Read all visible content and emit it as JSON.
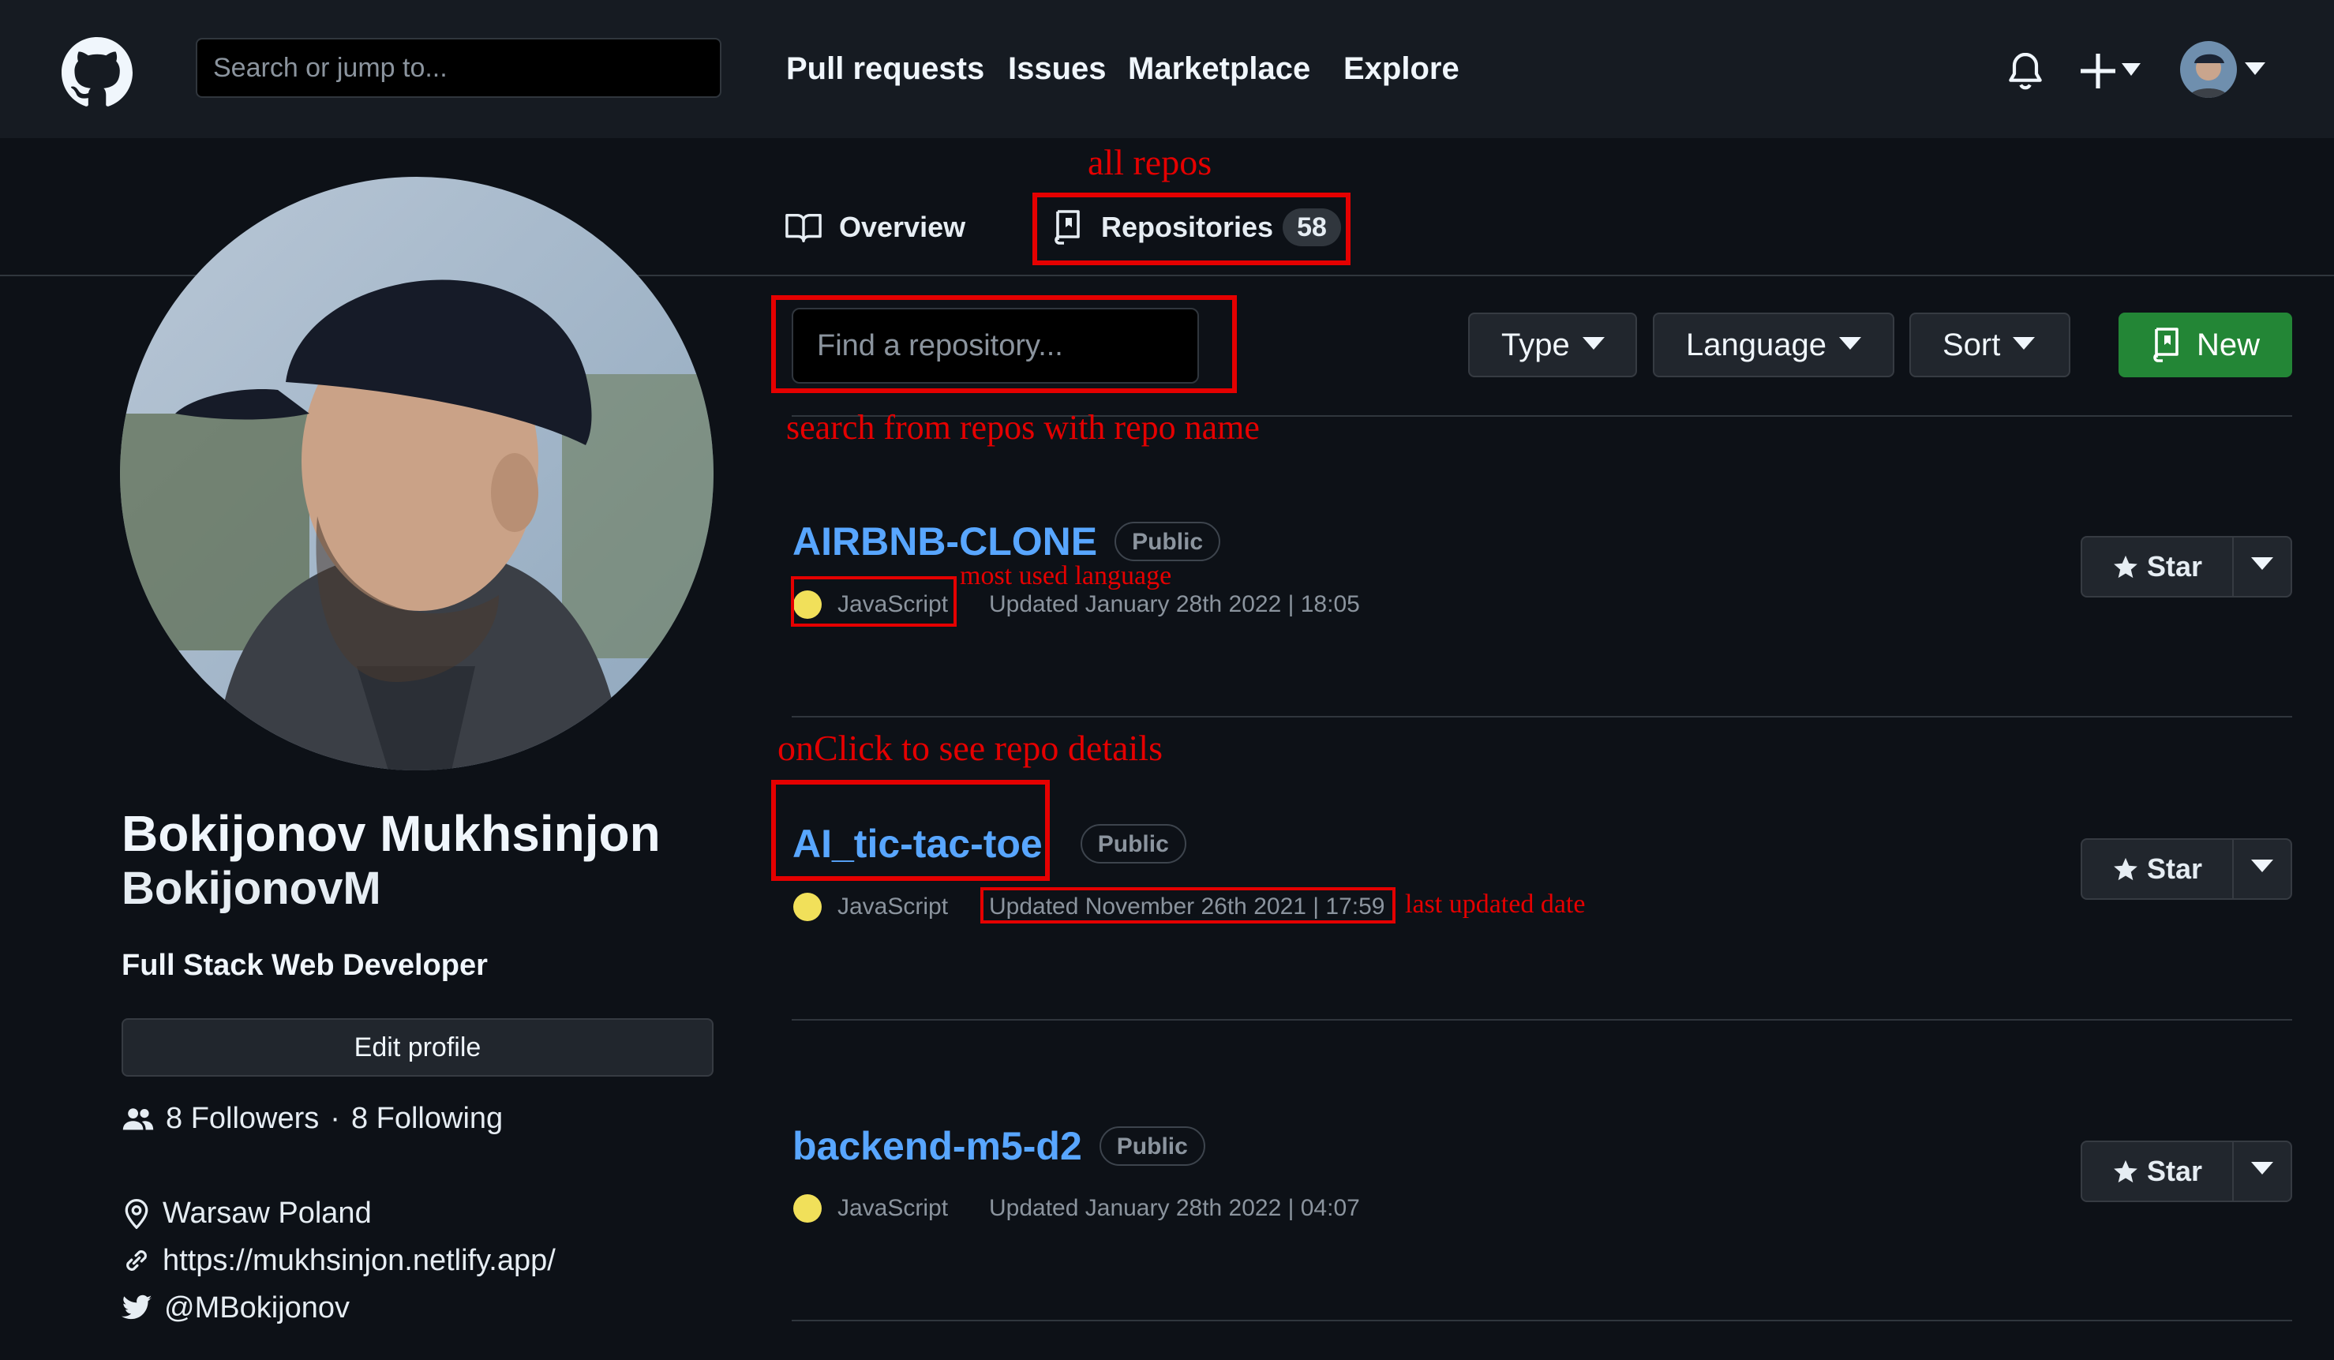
{
  "header": {
    "search_placeholder": "Search or jump to...",
    "nav": [
      "Pull requests",
      "Issues",
      "Marketplace",
      "Explore"
    ]
  },
  "tabs": {
    "overview": "Overview",
    "repositories": "Repositories",
    "repositories_count": "58"
  },
  "profile": {
    "name": "Bokijonov Mukhsinjon",
    "login": "BokijonovM",
    "bio": "Full Stack Web Developer",
    "edit_label": "Edit profile",
    "followers": "8 Followers",
    "separator": "·",
    "following": "8 Following",
    "location": "Warsaw Poland",
    "website": "https://mukhsinjon.netlify.app/",
    "twitter": "@MBokijonov"
  },
  "toolbar": {
    "search_placeholder": "Find a repository...",
    "type_label": "Type",
    "language_label": "Language",
    "sort_label": "Sort",
    "new_label": "New"
  },
  "repos": [
    {
      "name": "AIRBNB-CLONE",
      "visibility": "Public",
      "language": "JavaScript",
      "updated": "Updated January 28th 2022 | 18:05",
      "star_label": "Star"
    },
    {
      "name": "AI_tic-tac-toe",
      "visibility": "Public",
      "language": "JavaScript",
      "updated": "Updated November 26th 2021 | 17:59",
      "star_label": "Star"
    },
    {
      "name": "backend-m5-d2",
      "visibility": "Public",
      "language": "JavaScript",
      "updated": "Updated January 28th 2022 | 04:07",
      "star_label": "Star"
    }
  ],
  "annotations": {
    "all_repos": "all repos",
    "search_note": "search from repos with repo name",
    "most_used_language": "most used language",
    "onclick_note": "onClick to see repo details",
    "last_updated": "last updated date"
  },
  "colors": {
    "background": "#0d1117",
    "header": "#161b22",
    "link": "#58a6ff",
    "new_button": "#238636",
    "javascript": "#f1e05a",
    "annotation": "#e50000"
  }
}
